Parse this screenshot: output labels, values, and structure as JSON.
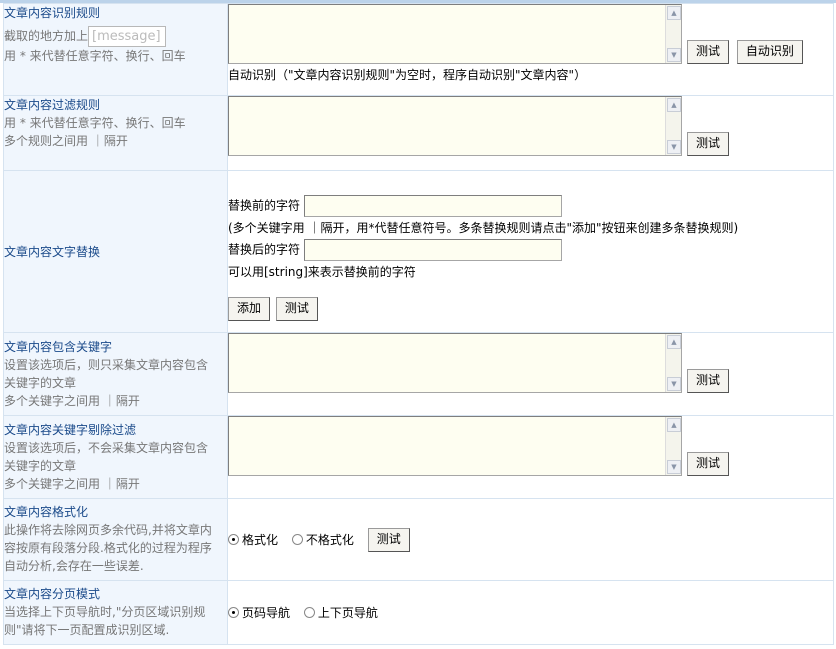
{
  "sections": {
    "recognition": {
      "title": "文章内容识别规则",
      "prefix_label": "截取的地方加上",
      "placeholder": "[message]",
      "desc": "用 * 来代替任意字符、换行、回车",
      "test_label": "测试",
      "auto_label": "自动识别",
      "note": "自动识别（\"文章内容识别规则\"为空时，程序自动识别\"文章内容\"）"
    },
    "filter": {
      "title": "文章内容过滤规则",
      "desc1": "用 * 来代替任意字符、换行、回车",
      "desc2": "多个规则之间用 ｜隔开",
      "test_label": "测试"
    },
    "replace": {
      "title": "文章内容文字替换",
      "before_label": "替换前的字符",
      "hint": "(多个关键字用 ｜隔开，用*代替任意符号。多条替换规则请点击\"添加\"按钮来创建多条替换规则)",
      "after_label": "替换后的字符",
      "after_hint": "可以用[string]来表示替换前的字符",
      "add_label": "添加",
      "test_label": "测试"
    },
    "include": {
      "title": "文章内容包含关键字",
      "desc1": "设置该选项后，则只采集文章内容包含",
      "desc2": "关键字的文章",
      "desc3": "多个关键字之间用 ｜隔开",
      "test_label": "测试"
    },
    "exclude": {
      "title": "文章内容关键字剔除过滤",
      "desc1": "设置该选项后，不会采集文章内容包含",
      "desc2": "关键字的文章",
      "desc3": "多个关键字之间用 ｜隔开",
      "test_label": "测试"
    },
    "format": {
      "title": "文章内容格式化",
      "desc1": "此操作将去除网页多余代码,并将文章内",
      "desc2": "容按原有段落分段.格式化的过程为程序",
      "desc3": "自动分析,会存在一些误差.",
      "opt_format": "格式化",
      "opt_noformat": "不格式化",
      "test_label": "测试"
    },
    "paging": {
      "title": "文章内容分页模式",
      "desc1": "当选择上下页导航时,\"分页区域识别规",
      "desc2": "则\"请将下一页配置成识别区域.",
      "opt_pagenum": "页码导航",
      "opt_prevnext": "上下页导航"
    }
  },
  "state": {
    "format_selected": "格式化",
    "paging_selected": "页码导航"
  },
  "colors": {
    "label_bg": "#f0f6fd",
    "title_blue": "#1a4a8a",
    "textarea_bg": "#fefef1",
    "border": "#d6e3f0"
  }
}
